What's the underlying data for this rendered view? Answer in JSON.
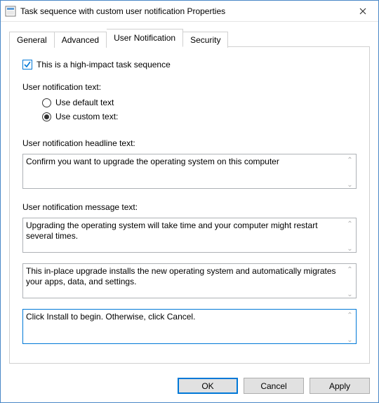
{
  "window": {
    "title": "Task sequence with custom user notification Properties"
  },
  "tabs": [
    {
      "label": "General"
    },
    {
      "label": "Advanced"
    },
    {
      "label": "User Notification"
    },
    {
      "label": "Security"
    }
  ],
  "activeTabIndex": 2,
  "panel": {
    "high_impact_label": "This is a high-impact task sequence",
    "high_impact_checked": true,
    "notif_text_label": "User notification text:",
    "radio_default_label": "Use default text",
    "radio_custom_label": "Use custom text:",
    "radio_selected": "custom",
    "headline_label": "User notification headline text:",
    "headline_value": "Confirm you want to upgrade the operating system on this computer",
    "message_label": "User notification message text:",
    "message1_value": "Upgrading the operating system will take time and your computer might restart several times.",
    "message2_value": "This in-place upgrade installs the new operating system and automatically migrates your apps, data, and settings.",
    "message3_value": "Click Install to begin. Otherwise, click Cancel."
  },
  "buttons": {
    "ok": "OK",
    "cancel": "Cancel",
    "apply": "Apply"
  }
}
